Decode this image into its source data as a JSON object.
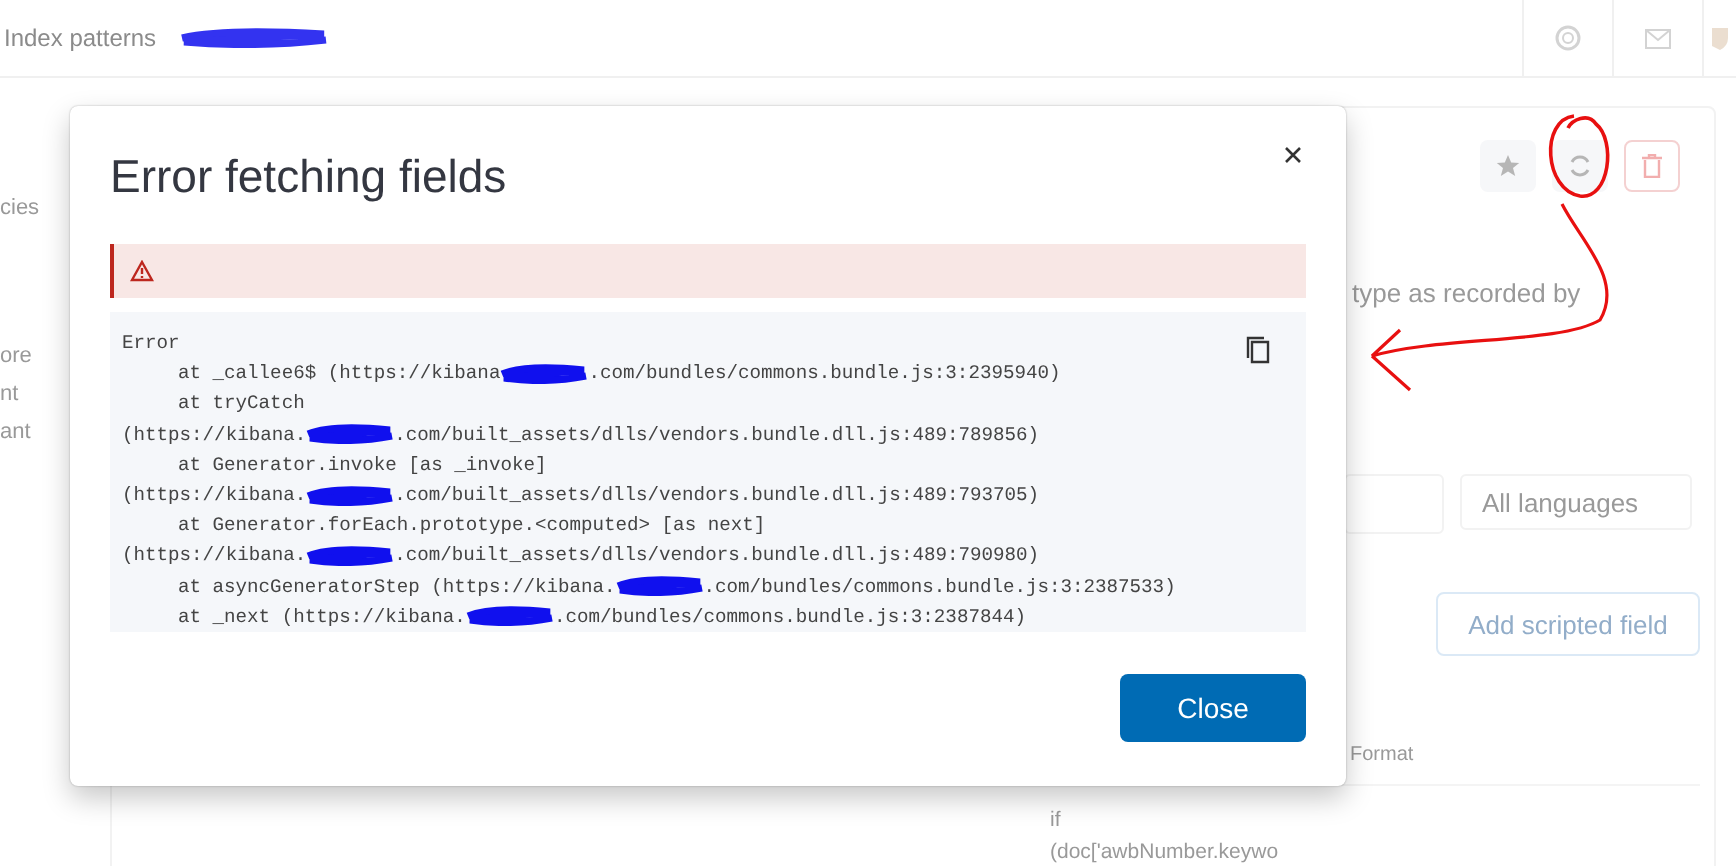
{
  "header": {
    "breadcrumb": "Index patterns"
  },
  "sidebar": {
    "items": [
      "cies",
      "ore",
      "nt",
      "ant"
    ]
  },
  "page": {
    "description": "type as recorded by",
    "language_select": "All languages",
    "add_button": "Add scripted field",
    "table_header": "Format",
    "table_cell_lines": [
      "if",
      "(doc['awbNumber.keywo"
    ]
  },
  "dialog": {
    "title": "Error fetching fields",
    "callout": {
      "kind": "danger"
    },
    "stack_lines": [
      {
        "kind": "head",
        "parts": [
          "Error"
        ]
      },
      {
        "kind": "frame",
        "parts": [
          "at _callee6$ (https://kibana",
          ".com/bundles/commons.bundle.js:3:2395940)"
        ]
      },
      {
        "kind": "frame",
        "parts": [
          "at tryCatch"
        ]
      },
      {
        "kind": "cont",
        "parts": [
          "(https://kibana.",
          ".com/built_assets/dlls/vendors.bundle.dll.js:489:789856)"
        ]
      },
      {
        "kind": "frame",
        "parts": [
          "at Generator.invoke [as _invoke]"
        ]
      },
      {
        "kind": "cont",
        "parts": [
          "(https://kibana.",
          ".com/built_assets/dlls/vendors.bundle.dll.js:489:793705)"
        ]
      },
      {
        "kind": "frame",
        "parts": [
          "at Generator.forEach.prototype.<computed> [as next]"
        ]
      },
      {
        "kind": "cont",
        "parts": [
          "(https://kibana.",
          ".com/built_assets/dlls/vendors.bundle.dll.js:489:790980)"
        ]
      },
      {
        "kind": "frame",
        "parts": [
          "at asyncGeneratorStep (https://kibana.",
          ".com/bundles/commons.bundle.js:3:2387533)"
        ]
      },
      {
        "kind": "frame",
        "parts": [
          "at _next (https://kibana.",
          ".com/bundles/commons.bundle.js:3:2387844)"
        ]
      }
    ],
    "close_button": "Close"
  }
}
